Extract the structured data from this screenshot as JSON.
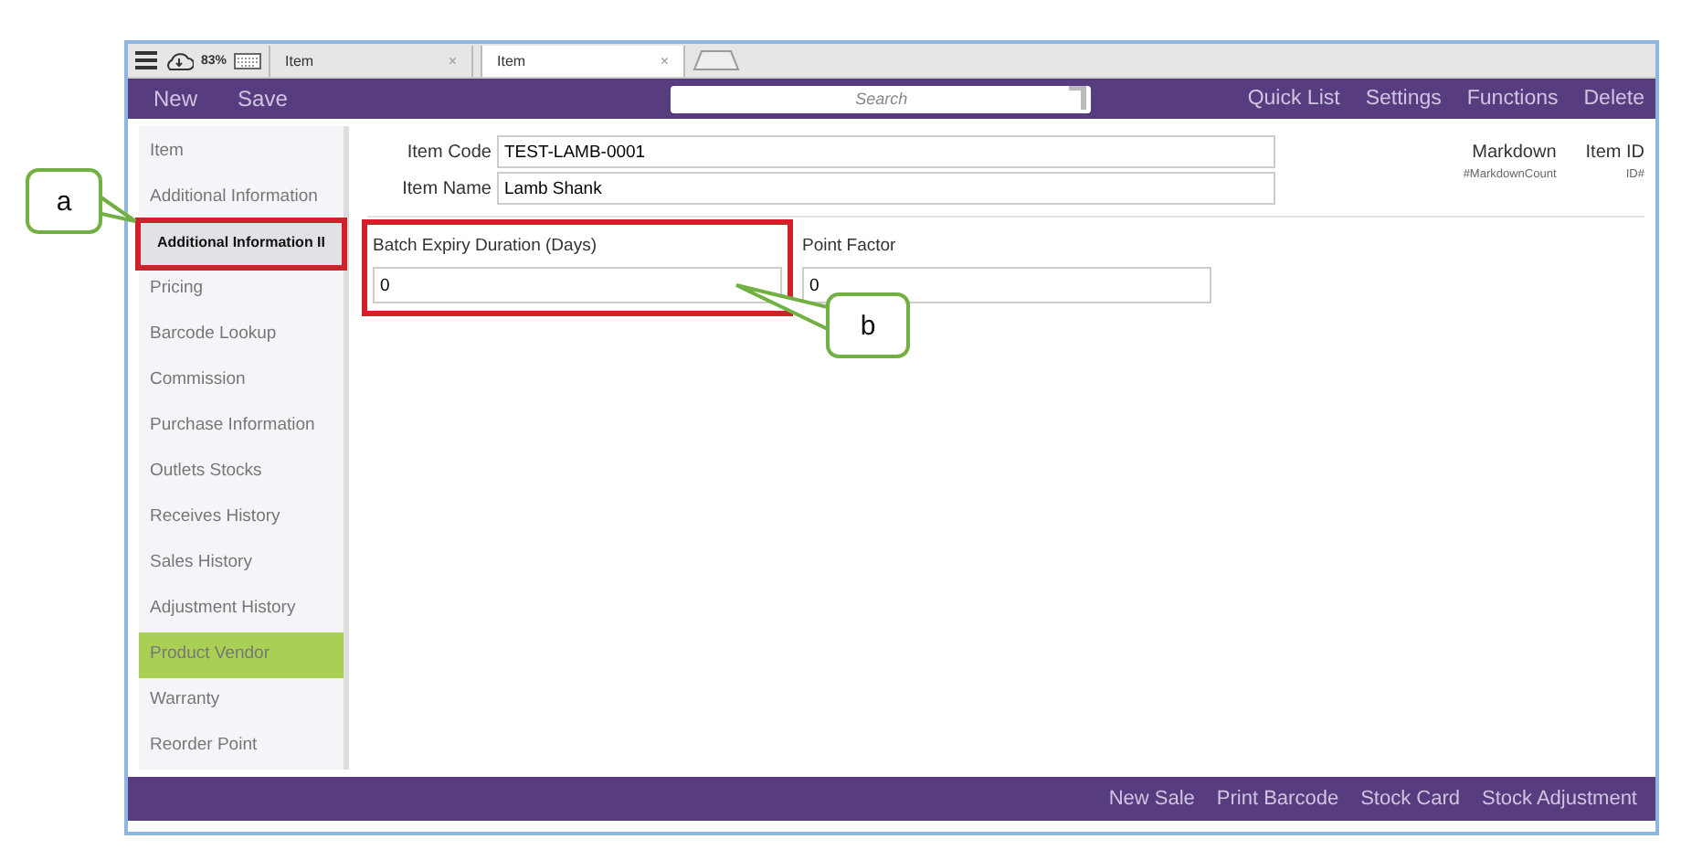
{
  "status": {
    "battery": "83%"
  },
  "tabs": [
    {
      "label": "Item",
      "selected": false,
      "close": "×"
    },
    {
      "label": "Item",
      "selected": true,
      "close": "×"
    }
  ],
  "toolbar": {
    "left": [
      "New",
      "Save"
    ],
    "search": {
      "placeholder": "Search"
    },
    "right": [
      "Quick List",
      "Settings",
      "Functions",
      "Delete"
    ]
  },
  "sidebar": {
    "items": [
      {
        "label": "Item",
        "selected": false,
        "hovered": false,
        "annotated": false
      },
      {
        "label": "Additional Information",
        "selected": false,
        "hovered": false,
        "annotated": false
      },
      {
        "label": "Additional Information II",
        "selected": true,
        "hovered": false,
        "annotated": true
      },
      {
        "label": "Pricing",
        "selected": false,
        "hovered": false,
        "annotated": false
      },
      {
        "label": "Barcode Lookup",
        "selected": false,
        "hovered": false,
        "annotated": false
      },
      {
        "label": "Commission",
        "selected": false,
        "hovered": false,
        "annotated": false
      },
      {
        "label": "Purchase Information",
        "selected": false,
        "hovered": false,
        "annotated": false
      },
      {
        "label": "Outlets Stocks",
        "selected": false,
        "hovered": false,
        "annotated": false
      },
      {
        "label": "Receives History",
        "selected": false,
        "hovered": false,
        "annotated": false
      },
      {
        "label": "Sales History",
        "selected": false,
        "hovered": false,
        "annotated": false
      },
      {
        "label": "Adjustment History",
        "selected": false,
        "hovered": false,
        "annotated": false
      },
      {
        "label": "Product Vendor",
        "selected": false,
        "hovered": true,
        "annotated": false
      },
      {
        "label": "Warranty",
        "selected": false,
        "hovered": false,
        "annotated": false
      },
      {
        "label": "Reorder Point",
        "selected": false,
        "hovered": false,
        "annotated": false
      }
    ]
  },
  "header": {
    "fields": [
      {
        "label": "Item Code",
        "value": "TEST-LAMB-0001"
      },
      {
        "label": "Item Name",
        "value": "Lamb Shank"
      }
    ],
    "info": [
      {
        "label": "Markdown",
        "value": "#MarkdownCount"
      },
      {
        "label": "Item ID",
        "value": "ID#"
      }
    ]
  },
  "form": {
    "fields": [
      {
        "label": "Batch Expiry Duration (Days)",
        "value": "0",
        "annotated": true
      },
      {
        "label": "Point Factor",
        "value": "0",
        "annotated": false
      }
    ]
  },
  "footer": {
    "actions": [
      "New Sale",
      "Print Barcode",
      "Stock Card",
      "Stock Adjustment"
    ]
  },
  "callouts": [
    {
      "label": "a"
    },
    {
      "label": "b"
    }
  ]
}
